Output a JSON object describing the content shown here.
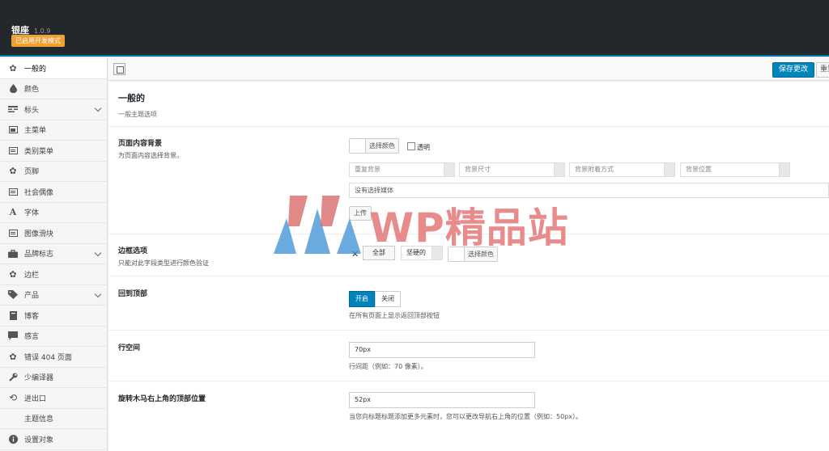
{
  "header": {
    "app_title": "银座",
    "version": "1.0.9",
    "dev_mode_badge": "已启用开发模式"
  },
  "sidebar": {
    "items": [
      {
        "label": "一般的",
        "icon": "gear-icon",
        "active": true,
        "expandable": false
      },
      {
        "label": "颜色",
        "icon": "drop-icon",
        "active": false,
        "expandable": false
      },
      {
        "label": "标头",
        "icon": "header-icon",
        "active": false,
        "expandable": true
      },
      {
        "label": "主菜单",
        "icon": "menu-icon",
        "active": false,
        "expandable": false
      },
      {
        "label": "类别菜单",
        "icon": "menu-icon",
        "active": false,
        "expandable": false
      },
      {
        "label": "页脚",
        "icon": "gear-icon",
        "active": false,
        "expandable": false
      },
      {
        "label": "社会偶像",
        "icon": "menu-icon",
        "active": false,
        "expandable": false
      },
      {
        "label": "字体",
        "icon": "font-icon",
        "active": false,
        "expandable": false
      },
      {
        "label": "图像滑块",
        "icon": "menu-icon",
        "active": false,
        "expandable": false
      },
      {
        "label": "品牌标志",
        "icon": "briefcase-icon",
        "active": false,
        "expandable": true
      },
      {
        "label": "边栏",
        "icon": "gear-icon",
        "active": false,
        "expandable": false
      },
      {
        "label": "产品",
        "icon": "tag-icon",
        "active": false,
        "expandable": true
      },
      {
        "label": "博客",
        "icon": "blog-icon",
        "active": false,
        "expandable": false
      },
      {
        "label": "感言",
        "icon": "comment-icon",
        "active": false,
        "expandable": false
      },
      {
        "label": "错误 404 页面",
        "icon": "gear-icon",
        "active": false,
        "expandable": false
      },
      {
        "label": "少编译器",
        "icon": "wrench-icon",
        "active": false,
        "expandable": false
      },
      {
        "label": "进出口",
        "icon": "refresh-icon",
        "active": false,
        "expandable": false
      },
      {
        "label": "主题信息",
        "icon": "",
        "active": false,
        "expandable": false
      },
      {
        "label": "设置对象",
        "icon": "info-icon",
        "active": false,
        "expandable": false
      }
    ]
  },
  "toolbar": {
    "save_label": "保存更改",
    "reset_label": "重置"
  },
  "main": {
    "section_title": "一般的",
    "section_subtitle": "一般主题选项",
    "page_bg": {
      "label": "页面内容背景",
      "desc": "为页面内容选择背景。",
      "color_btn": "选择颜色",
      "transparent_label": "透明",
      "repeat_placeholder": "重复背景",
      "size_placeholder": "背景尺寸",
      "attach_placeholder": "背景附着方式",
      "position_placeholder": "背景位置",
      "media_text": "没有选择媒体",
      "upload_label": "上传"
    },
    "border": {
      "label": "边框选项",
      "desc": "只能对此字段类型进行颜色验证",
      "all_label": "全部",
      "style_value": "坚硬的",
      "color_btn": "选择颜色"
    },
    "back_to_top": {
      "label": "回到顶部",
      "on_label": "开启",
      "off_label": "关闭",
      "hint": "在所有页面上显示返回顶部按钮",
      "enabled": true
    },
    "line_height": {
      "label": "行空间",
      "value": "70px",
      "hint": "行间距（例如：70 像素）。"
    },
    "carousel_top": {
      "label": "旋转木马右上角的顶部位置",
      "value": "52px",
      "hint": "当您向标题标题添加更多元素时，您可以更改导航右上角的位置（例如：50px）。"
    }
  },
  "watermark": {
    "text": "WP精品站",
    "logo_colors": [
      "#d96b6b",
      "#3b8fd6"
    ]
  }
}
